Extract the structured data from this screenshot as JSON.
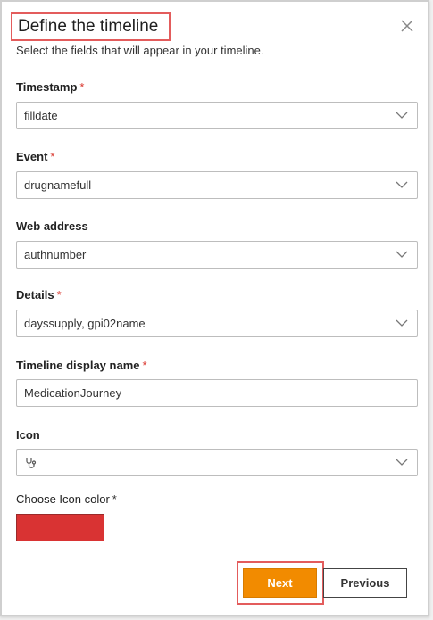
{
  "dialog": {
    "title": "Define the timeline",
    "subtitle": "Select the fields that will appear in your timeline."
  },
  "fields": {
    "timestamp": {
      "label": "Timestamp",
      "required": "*",
      "value": "filldate"
    },
    "event": {
      "label": "Event",
      "required": "*",
      "value": "drugnamefull"
    },
    "web_address": {
      "label": "Web address",
      "value": "authnumber"
    },
    "details": {
      "label": "Details",
      "required": "*",
      "value": "dayssupply, gpi02name"
    },
    "display_name": {
      "label": "Timeline display name",
      "required": "*",
      "value": "MedicationJourney"
    },
    "icon": {
      "label": "Icon",
      "icon_name": "stethoscope-icon"
    },
    "icon_color": {
      "label": "Choose Icon color",
      "required": "*",
      "color": "#d93333"
    }
  },
  "buttons": {
    "next": "Next",
    "previous": "Previous"
  },
  "colors": {
    "accent": "#f28b00",
    "required": "#d9342b",
    "highlight": "#e35c5c"
  }
}
